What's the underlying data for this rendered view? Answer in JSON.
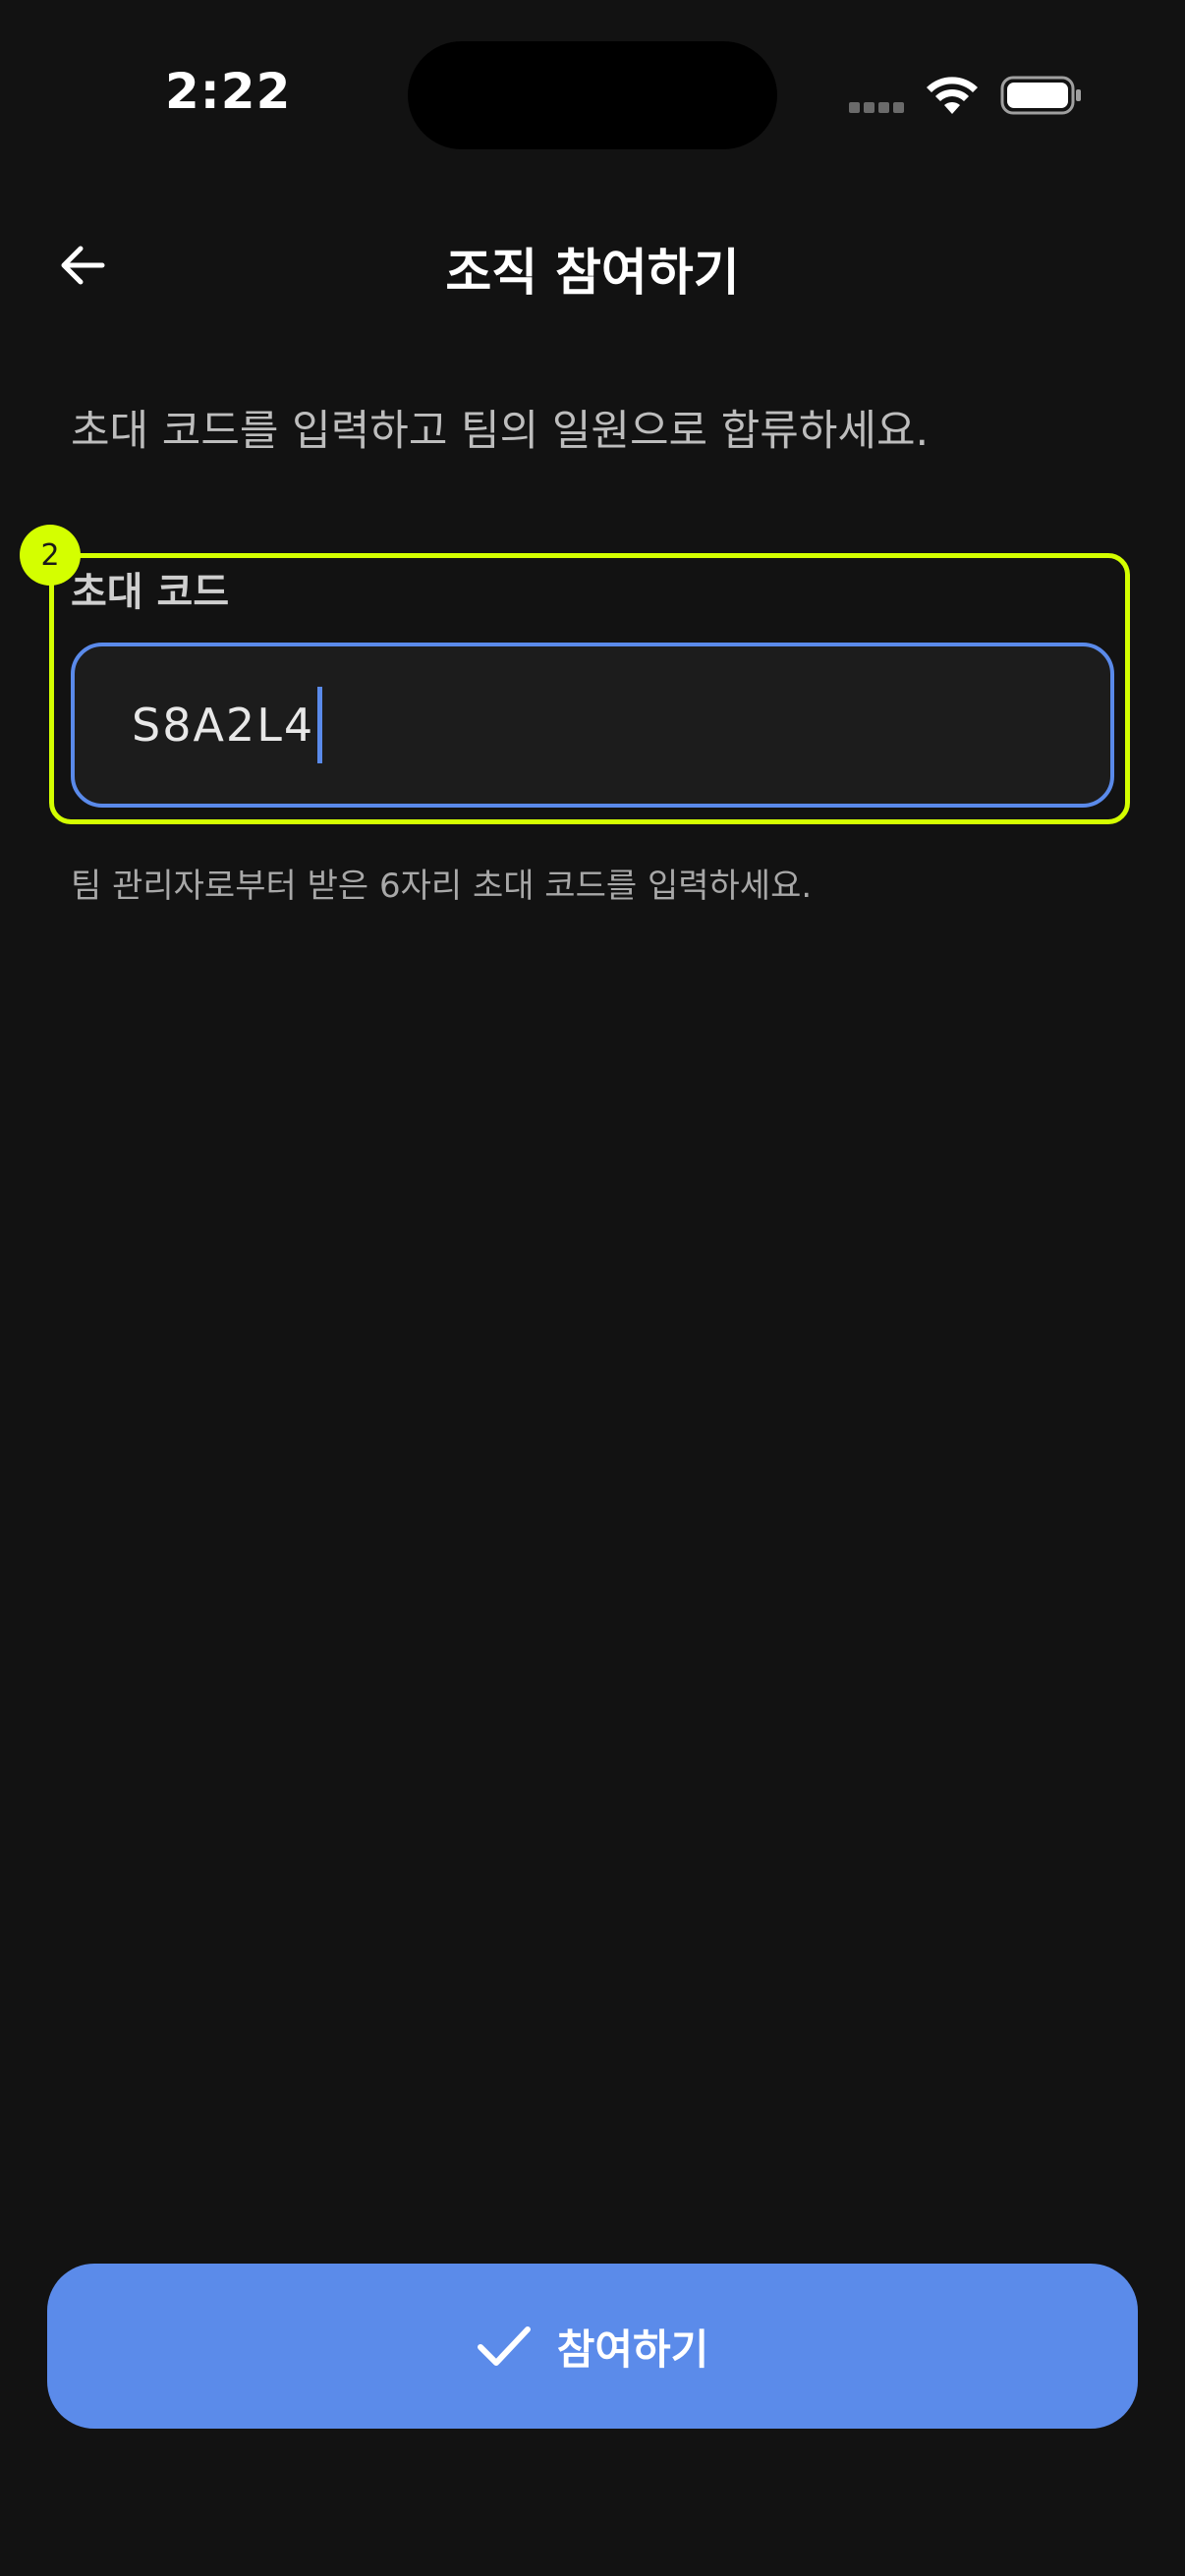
{
  "status_bar": {
    "time": "2:22"
  },
  "header": {
    "back_icon": "arrow-left-icon",
    "title": "조직 참여하기"
  },
  "description": "초대 코드를 입력하고 팀의 일원으로 합류하세요.",
  "form": {
    "highlight_badge": "2",
    "label": "초대 코드",
    "code_value": "S8A2L4",
    "helper_text": "팀 관리자로부터 받은 6자리 초대 코드를 입력하세요."
  },
  "join_button": {
    "icon": "check-icon",
    "label": "참여하기"
  },
  "colors": {
    "background": "#121212",
    "accent": "#5b8bea",
    "highlight": "#d4ff00"
  }
}
